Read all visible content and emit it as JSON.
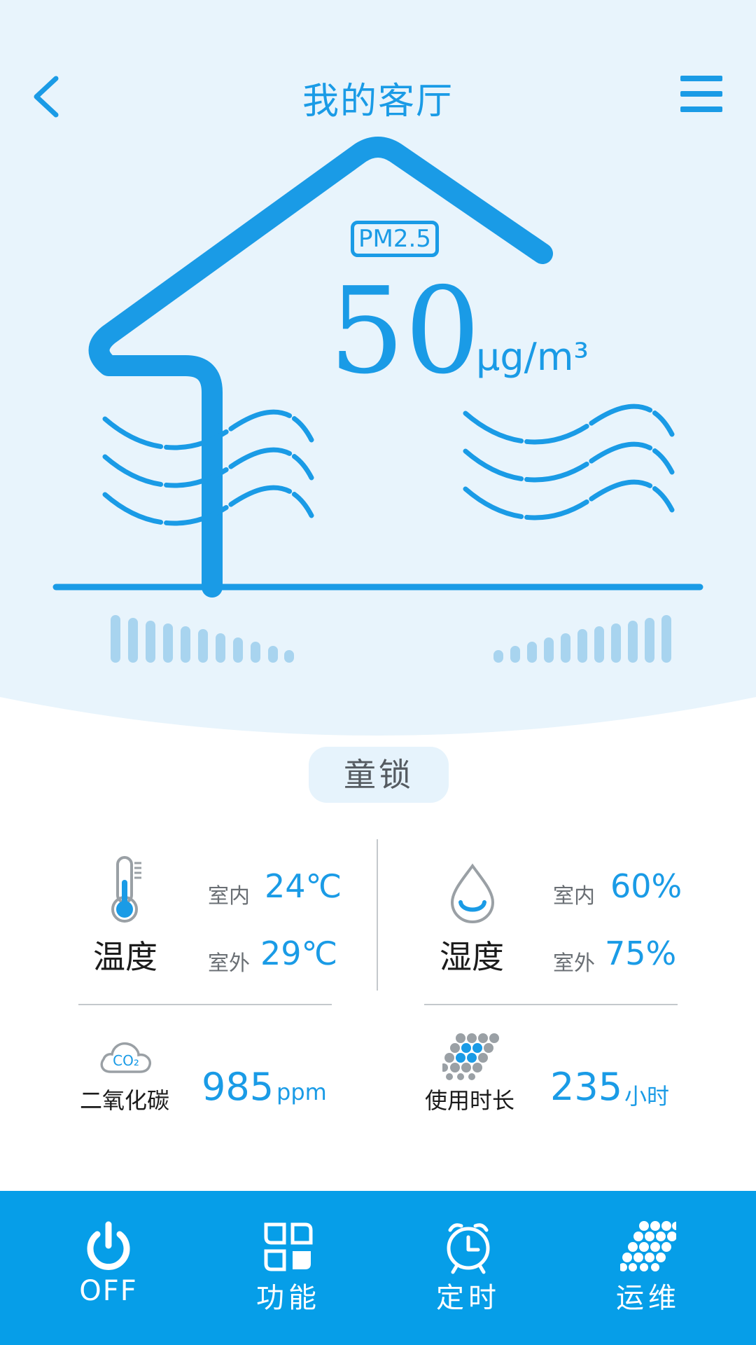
{
  "header": {
    "title": "我的客厅"
  },
  "air": {
    "badge": "PM2.5",
    "value": "50",
    "unit": "μg/m³"
  },
  "child_lock": {
    "label": "童锁"
  },
  "temperature": {
    "title": "温度",
    "indoor_label": "室内",
    "indoor_value": "24℃",
    "outdoor_label": "室外",
    "outdoor_value": "29℃"
  },
  "humidity": {
    "title": "湿度",
    "indoor_label": "室内",
    "indoor_value": "60%",
    "outdoor_label": "室外",
    "outdoor_value": "75%"
  },
  "co2": {
    "title": "二氧化碳",
    "icon_text": "CO₂",
    "value": "985",
    "unit": "ppm"
  },
  "usage": {
    "title": "使用时长",
    "value": "235",
    "unit": "小时"
  },
  "bottom_nav": {
    "items": [
      {
        "label": "OFF",
        "icon": "power-icon"
      },
      {
        "label": "功能",
        "icon": "function-grid-icon"
      },
      {
        "label": "定时",
        "icon": "alarm-clock-icon"
      },
      {
        "label": "运维",
        "icon": "filter-honeycomb-icon"
      }
    ]
  },
  "colors": {
    "accent": "#1a9be6",
    "hero_background": "#e8f4fc",
    "bar_light": "#a8d4ef",
    "bottom_bar": "#069ee8"
  }
}
